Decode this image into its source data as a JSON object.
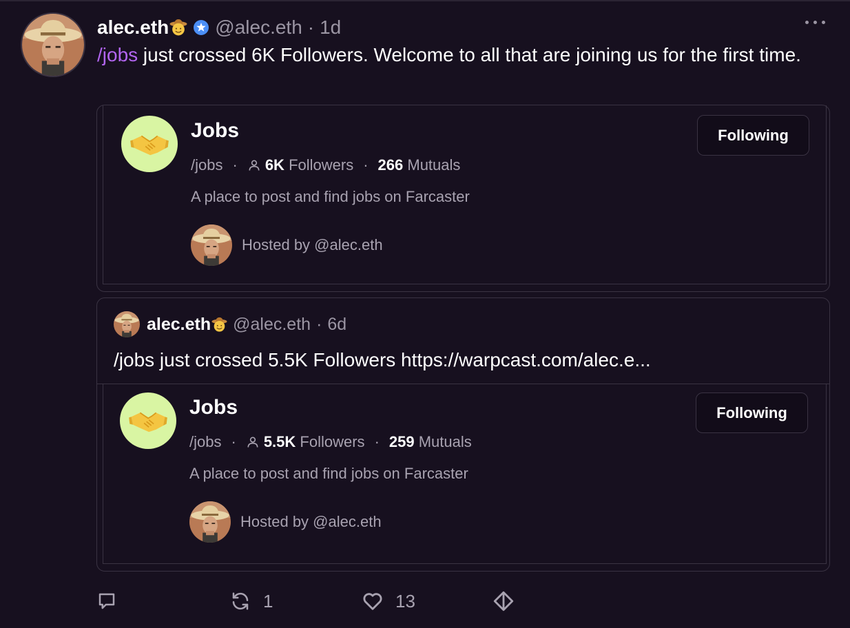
{
  "post": {
    "author_name": "alec.eth",
    "author_handle": "@alec.eth",
    "separator": "·",
    "time": "1d",
    "channel_link": "/jobs",
    "text": " just crossed 6K Followers. Welcome to all that are joining us for the first time."
  },
  "channel_card": {
    "title": "Jobs",
    "path": "/jobs",
    "followers_count": "6K",
    "followers_label": "Followers",
    "mutuals_count": "266",
    "mutuals_label": "Mutuals",
    "description": "A place to post and find jobs on Farcaster",
    "hosted_by": "Hosted by @alec.eth",
    "button_label": "Following"
  },
  "quoted_cast": {
    "author_name": "alec.eth",
    "author_handle": "@alec.eth",
    "time": "6d",
    "text": "/jobs just crossed 5.5K Followers https://warpcast.com/alec.e...",
    "channel_card": {
      "title": "Jobs",
      "path": "/jobs",
      "followers_count": "5.5K",
      "followers_label": "Followers",
      "mutuals_count": "259",
      "mutuals_label": "Mutuals",
      "description": "A place to post and find jobs on Farcaster",
      "hosted_by": "Hosted by @alec.eth",
      "button_label": "Following"
    }
  },
  "actions": {
    "reply_count": "",
    "recast_count": "1",
    "like_count": "13"
  },
  "icons": {
    "more": "more-horizontal-icon",
    "verified": "verified-badge-icon",
    "reply": "comment-icon",
    "recast": "recast-icon",
    "like": "heart-icon",
    "tip": "diamond-icon",
    "person": "person-icon",
    "channel": "handshake-icon"
  },
  "colors": {
    "background": "#17101f",
    "channel_link": "#b265f0",
    "muted_text": "#a8a2b0",
    "channel_avatar_bg": "#d9f5a3",
    "verified": "#4b8ef5"
  }
}
